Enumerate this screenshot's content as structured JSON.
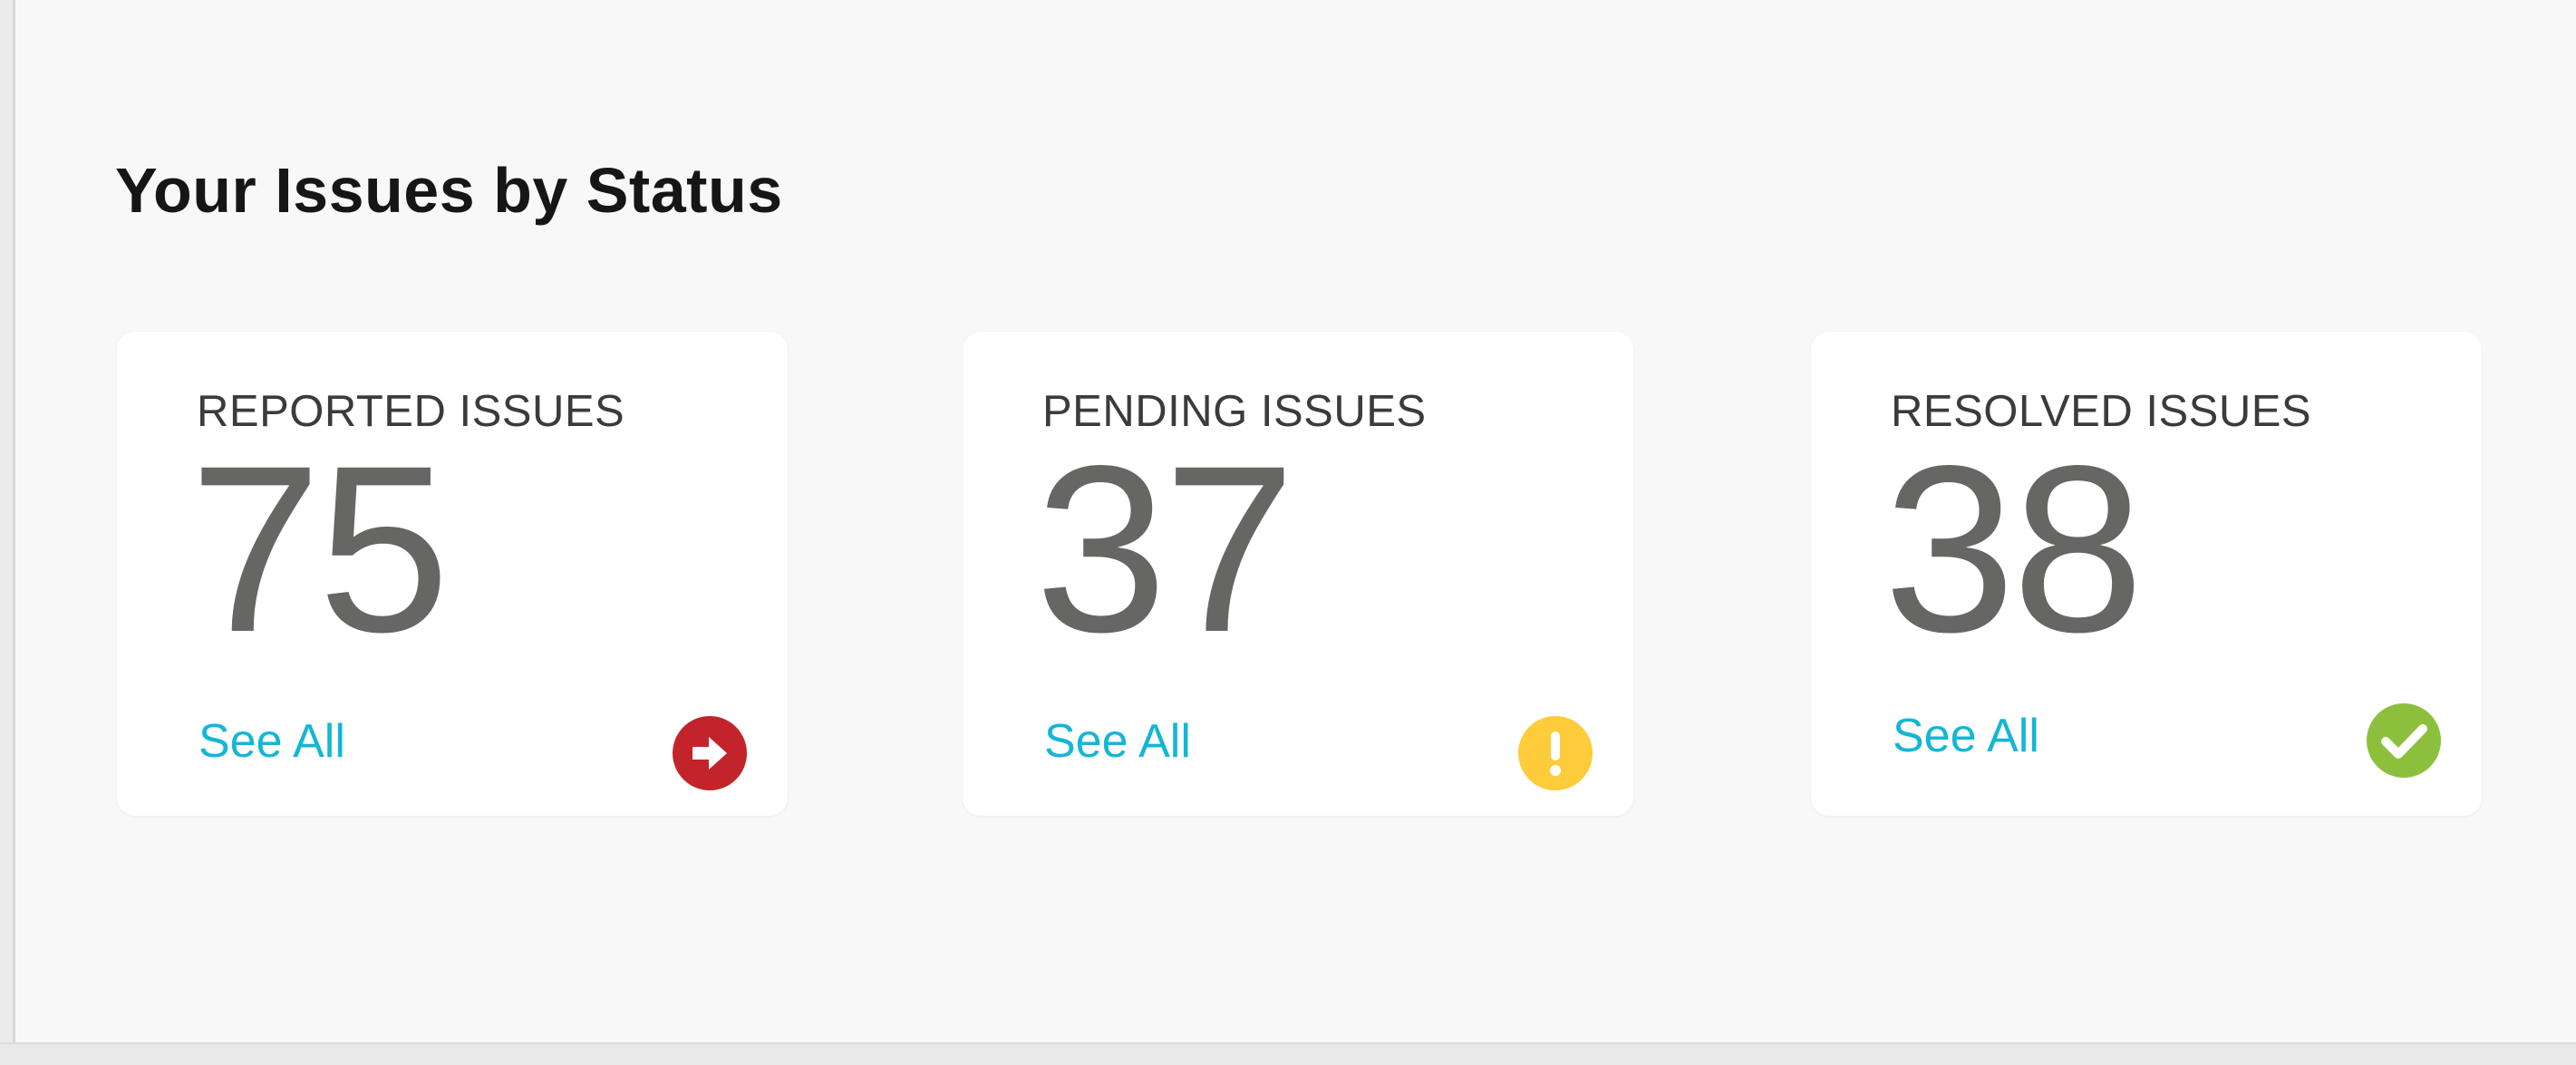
{
  "section": {
    "title": "Your Issues by Status"
  },
  "cards": [
    {
      "label": "REPORTED ISSUES",
      "count": "75",
      "link": "See All",
      "icon": "arrow-right-icon",
      "icon_color": "#c3242b"
    },
    {
      "label": "PENDING ISSUES",
      "count": "37",
      "link": "See All",
      "icon": "exclamation-icon",
      "icon_color": "#fecb3a"
    },
    {
      "label": "RESOLVED ISSUES",
      "count": "38",
      "link": "See All",
      "icon": "checkmark-icon",
      "icon_color": "#8cc03c"
    }
  ],
  "colors": {
    "link": "#14b6d6",
    "count": "#666664",
    "label": "#3b3b3b",
    "background": "#f8f8f8",
    "card": "#ffffff"
  }
}
